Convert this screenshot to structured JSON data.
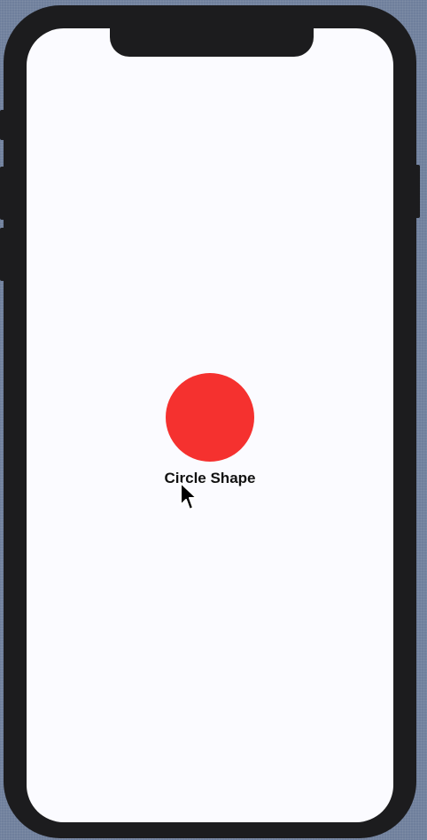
{
  "colors": {
    "circle_fill": "#f5312f",
    "label_color": "#111111",
    "screen_background": "#fbfbff",
    "device_frame": "#1c1c1e"
  },
  "screen": {
    "shape_label": "Circle Shape"
  },
  "icons": {
    "cursor": "mouse-pointer-arrow"
  }
}
